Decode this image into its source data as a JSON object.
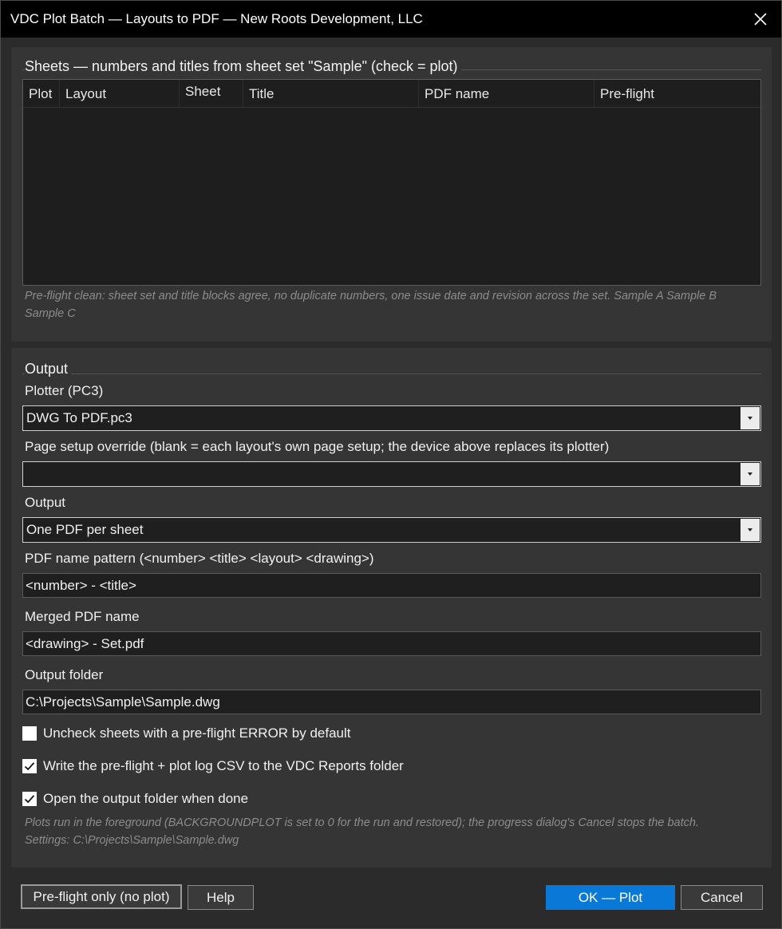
{
  "window": {
    "title": "VDC Plot Batch — Layouts to PDF — New Roots Development, LLC"
  },
  "sheets": {
    "group_title": "Sheets — numbers and titles from sheet set \"Sample\" (check = plot)",
    "columns": [
      "Plot",
      "Layout",
      "Sheet",
      "Title",
      "PDF name",
      "Pre-flight"
    ],
    "preflight_note": "Pre-flight clean: sheet set and title blocks agree, no duplicate numbers, one issue date and revision across the set. Sample A Sample B Sample C"
  },
  "output": {
    "group_title": "Output",
    "plotter_label": "Plotter (PC3)",
    "plotter_value": "DWG To PDF.pc3",
    "page_setup_label": "Page setup override (blank = each layout's own page setup; the device above replaces its plotter)",
    "page_setup_value": "",
    "output_label": "Output",
    "output_value": "One PDF per sheet",
    "pdf_pattern_label": "PDF name pattern (<number> <title> <layout> <drawing>)",
    "pdf_pattern_value": "<number> - <title>",
    "merged_label": "Merged PDF name",
    "merged_value": "<drawing> - Set.pdf",
    "folder_label": "Output folder",
    "folder_value": "C:\\Projects\\Sample\\Sample.dwg",
    "options": [
      {
        "label": "Uncheck sheets with a pre-flight ERROR by default",
        "checked": false
      },
      {
        "label": "Write the pre-flight + plot log CSV to the VDC Reports folder",
        "checked": true
      },
      {
        "label": "Open the output folder when done",
        "checked": true
      }
    ],
    "footer_note_1": "Plots run in the foreground (BACKGROUNDPLOT is set to 0 for the run and restored); the progress dialog's Cancel stops the batch.",
    "footer_note_2": "Settings: C:\\Projects\\Sample\\Sample.dwg"
  },
  "buttons": {
    "preflight": "Pre-flight  only  (no plot)",
    "help": "Help",
    "ok": "OK — Plot",
    "cancel": "Cancel"
  },
  "colors": {
    "accent": "#0a78d7",
    "titlebar": "#000000",
    "panel": "#353535"
  },
  "icons": {
    "close": "close-icon",
    "dropdown": "chevron-down-icon",
    "check": "checkmark-icon"
  }
}
